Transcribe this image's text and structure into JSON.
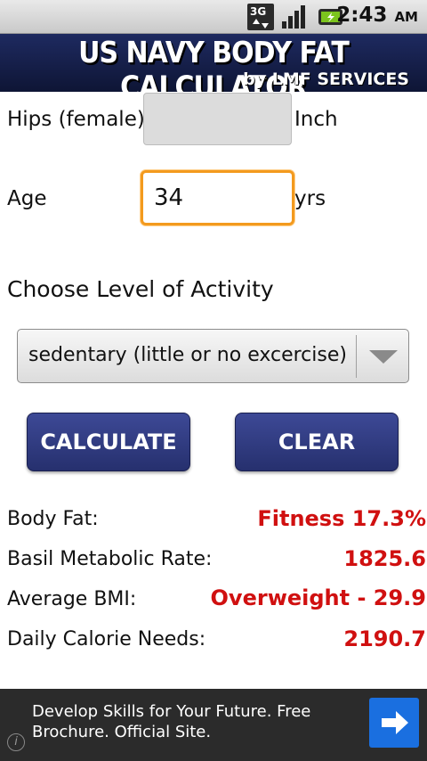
{
  "status_bar": {
    "time": "2:43",
    "ampm": "AM",
    "network": "3G"
  },
  "banner": {
    "title": "US NAVY BODY FAT CALCULATOR",
    "subtitle": "by LMF SERVICES"
  },
  "form": {
    "hips_label": "Hips (female):",
    "hips_value": "",
    "hips_unit": "Inch",
    "age_label": "Age",
    "age_value": "34",
    "age_unit": "yrs"
  },
  "activity": {
    "heading": "Choose Level of Activity",
    "selected": "sedentary (little or no excercise)"
  },
  "buttons": {
    "calculate": "CALCULATE",
    "clear": "CLEAR"
  },
  "results": [
    {
      "label": "Body Fat:",
      "value": "Fitness 17.3%"
    },
    {
      "label": "Basil Metabolic Rate:",
      "value": "1825.6"
    },
    {
      "label": "Average BMI:",
      "value": "Overweight - 29.9"
    },
    {
      "label": "Daily Calorie Needs:",
      "value": "2190.7"
    }
  ],
  "ad": {
    "text": "Develop Skills for Your Future. Free Brochure. Official Site.",
    "info_glyph": "i"
  },
  "colors": {
    "accent": "#f39a1e",
    "button": "#2e3a80",
    "result": "#d01010"
  }
}
